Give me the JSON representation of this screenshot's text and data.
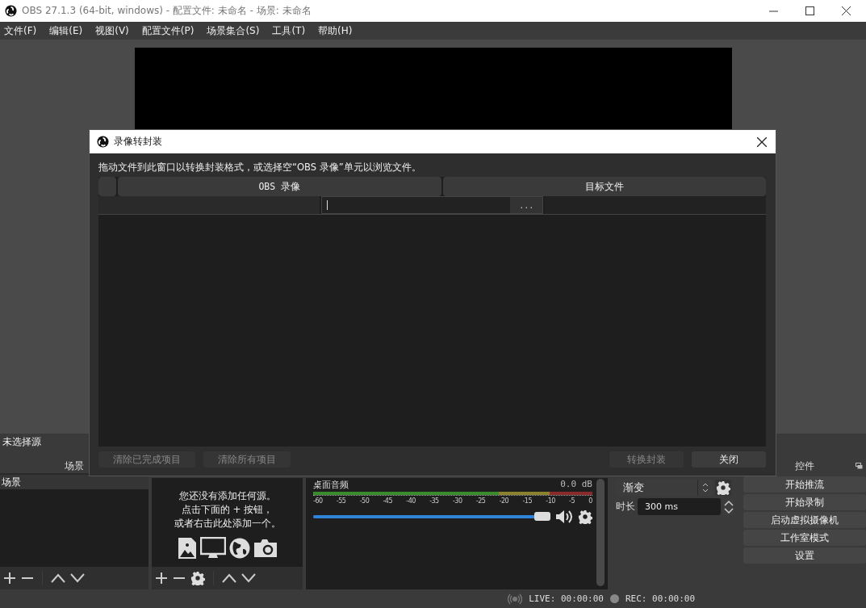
{
  "window": {
    "title": "OBS 27.1.3 (64-bit, windows) - 配置文件: 未命名 - 场景: 未命名"
  },
  "menu": [
    "文件(F)",
    "编辑(E)",
    "视图(V)",
    "配置文件(P)",
    "场景集合(S)",
    "工具(T)",
    "帮助(H)"
  ],
  "source_label": "未选择源",
  "scenes": {
    "title": "场景",
    "items": [
      {
        "label": "场景",
        "selected": true
      }
    ]
  },
  "sources": {
    "empty_message": [
      "您还没有添加任何源。",
      "点击下面的 + 按钮，",
      "或者右击此处添加一个。"
    ]
  },
  "mixer": {
    "channels": [
      {
        "name": "桌面音频",
        "reading": "0.0 dB",
        "scale": [
          "-60",
          "-55",
          "-50",
          "-45",
          "-40",
          "-35",
          "-30",
          "-25",
          "-20",
          "-15",
          "-10",
          "-5",
          "0"
        ],
        "level": 1,
        "muted": false
      }
    ]
  },
  "transitions": {
    "value": "渐变",
    "duration_label": "时长",
    "duration": "300 ms"
  },
  "controls": {
    "title": "控件",
    "buttons": [
      "开始推流",
      "开始录制",
      "启动虚拟摄像机",
      "工作室模式",
      "设置"
    ]
  },
  "status": {
    "live": "LIVE: 00:00:00",
    "rec": "REC: 00:00:00"
  },
  "dialog": {
    "title": "录像转封装",
    "instructions": "拖动文件到此窗口以转换封装格式，或选择空“OBS 录像”单元以浏览文件。",
    "columns": [
      "OBS 录像",
      "目标文件"
    ],
    "rows": [
      {
        "source": "",
        "browse": "...",
        "target": ""
      }
    ],
    "left_buttons": [
      {
        "label": "清除已完成项目",
        "disabled": true
      },
      {
        "label": "清除所有项目",
        "disabled": true
      }
    ],
    "right_buttons": [
      {
        "label": "转换封装",
        "disabled": true
      },
      {
        "label": "关闭",
        "disabled": false
      }
    ]
  }
}
